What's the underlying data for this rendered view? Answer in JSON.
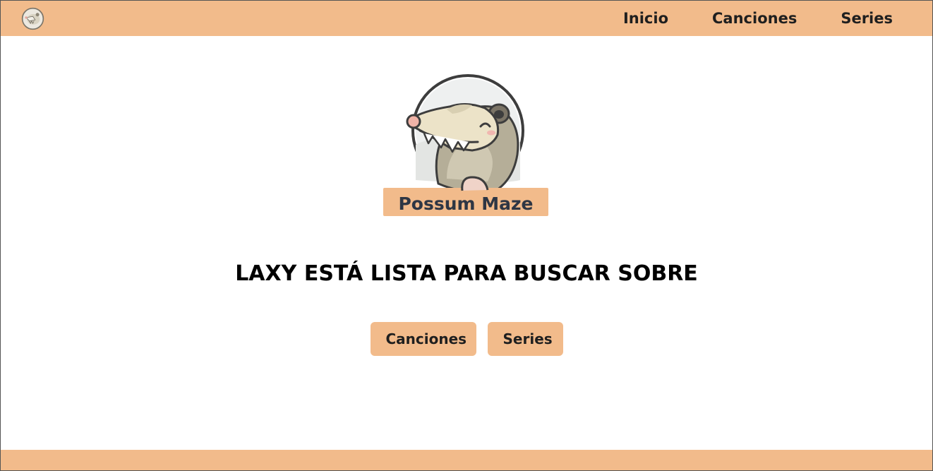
{
  "nav": {
    "logo_icon": "possum-logo-icon",
    "links": [
      "Inicio",
      "Canciones",
      "Series"
    ]
  },
  "hero": {
    "logo_text": "Possum Maze",
    "headline": "LAXY ESTÁ LISTA PARA BUSCAR SOBRE"
  },
  "actions": {
    "canciones_label": "Canciones",
    "series_label": "Series"
  },
  "colors": {
    "accent": "#f2bb8b",
    "text": "#1f1f1f"
  }
}
